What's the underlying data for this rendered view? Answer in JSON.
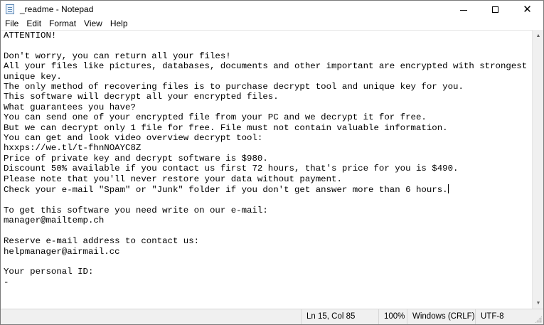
{
  "window": {
    "title": "_readme - Notepad",
    "app_icon": "notepad-icon",
    "controls": {
      "minimize": "minimize-icon",
      "maximize": "maximize-icon",
      "close": "close-icon"
    }
  },
  "menu": {
    "items": [
      "File",
      "Edit",
      "Format",
      "View",
      "Help"
    ]
  },
  "document": {
    "lines": [
      "ATTENTION!",
      "",
      "Don't worry, you can return all your files!",
      "All your files like pictures, databases, documents and other important are encrypted with strongest encryption and",
      "unique key.",
      "The only method of recovering files is to purchase decrypt tool and unique key for you.",
      "This software will decrypt all your encrypted files.",
      "What guarantees you have?",
      "You can send one of your encrypted file from your PC and we decrypt it for free.",
      "But we can decrypt only 1 file for free. File must not contain valuable information.",
      "You can get and look video overview decrypt tool:",
      "hxxps://we.tl/t-fhnNOAYC8Z",
      "Price of private key and decrypt software is $980.",
      "Discount 50% available if you contact us first 72 hours, that's price for you is $490.",
      "Please note that you'll never restore your data without payment.",
      "Check your e-mail \"Spam\" or \"Junk\" folder if you don't get answer more than 6 hours.",
      "",
      "To get this software you need write on our e-mail:",
      "manager@mailtemp.ch",
      "",
      "Reserve e-mail address to contact us:",
      "helpmanager@airmail.cc",
      "",
      "Your personal ID:",
      "-"
    ]
  },
  "status": {
    "position": "Ln 15, Col 85",
    "zoom": "100%",
    "line_ending": "Windows (CRLF)",
    "encoding": "UTF-8"
  }
}
